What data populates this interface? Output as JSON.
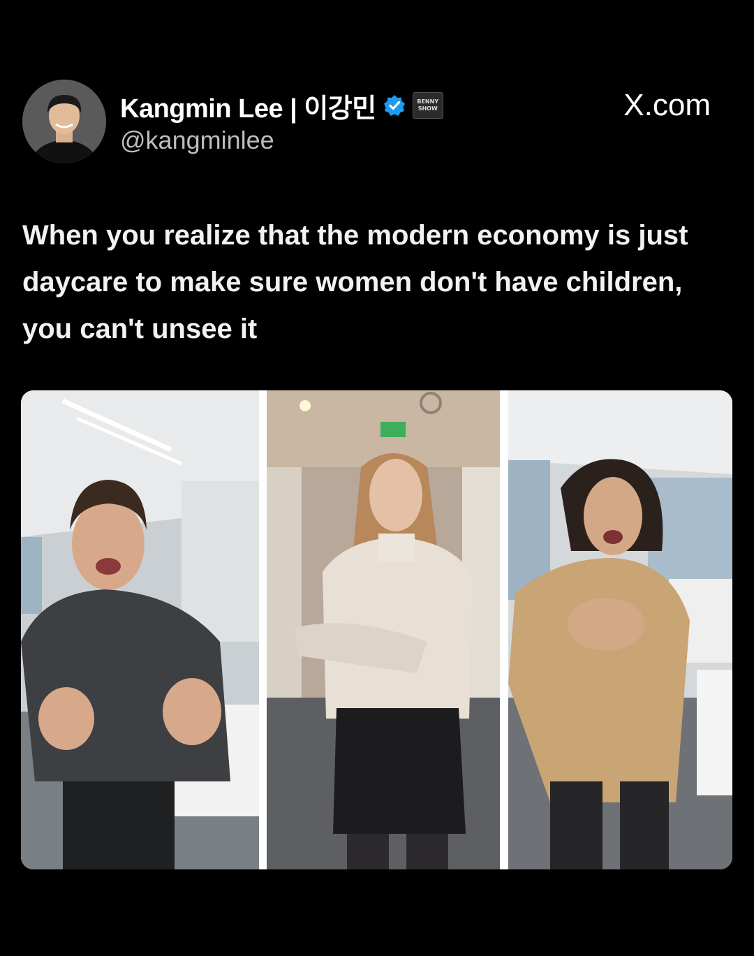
{
  "author": {
    "display_name": "Kangmin Lee | 이강민",
    "handle": "@kangminlee",
    "verified_icon": "verified-badge-icon",
    "badge_text_line1": "BENNY",
    "badge_text_line2": "SHOW"
  },
  "site_label": "X.com",
  "tweet": {
    "text": "When you realize that the modern economy is just daycare to make sure women don't have children, you can't unsee it"
  },
  "media": {
    "panels": [
      {
        "name": "office-woman-left"
      },
      {
        "name": "office-woman-middle"
      },
      {
        "name": "office-woman-right"
      }
    ]
  },
  "colors": {
    "background": "#000000",
    "verified_blue": "#1d9bf0",
    "text": "#f2f2f2",
    "handle": "#bdbdbd"
  }
}
